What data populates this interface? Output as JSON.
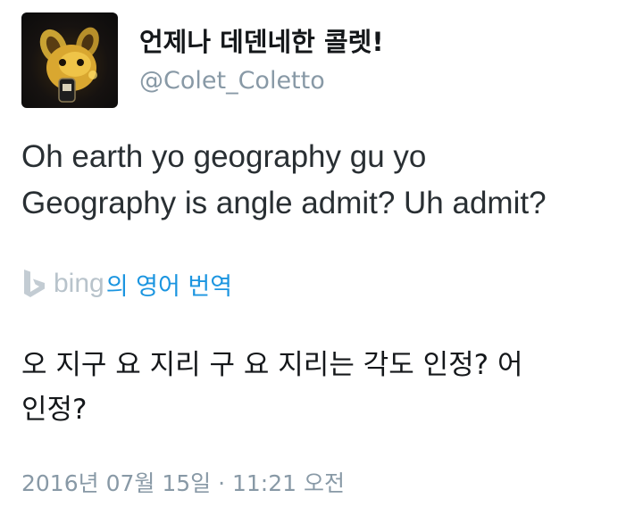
{
  "author": {
    "display_name": "언제나 데덴네한 콜렛!",
    "handle": "@Colet_Coletto",
    "avatar_icon": "dedenne-avatar"
  },
  "tweet": {
    "lines": [
      "Oh earth yo geography gu yo",
      "Geography is angle admit? Uh admit?"
    ]
  },
  "translation": {
    "provider_icon": "bing-icon",
    "provider_name": "bing",
    "label": "의 영어 번역",
    "lines": [
      "오 지구 요 지리 구 요 지리는 각도 인정? 어",
      "인정?"
    ],
    "link_color": "#1b95e0"
  },
  "meta": {
    "timestamp": "2016년 07월 15일 · 11:21 오전"
  }
}
